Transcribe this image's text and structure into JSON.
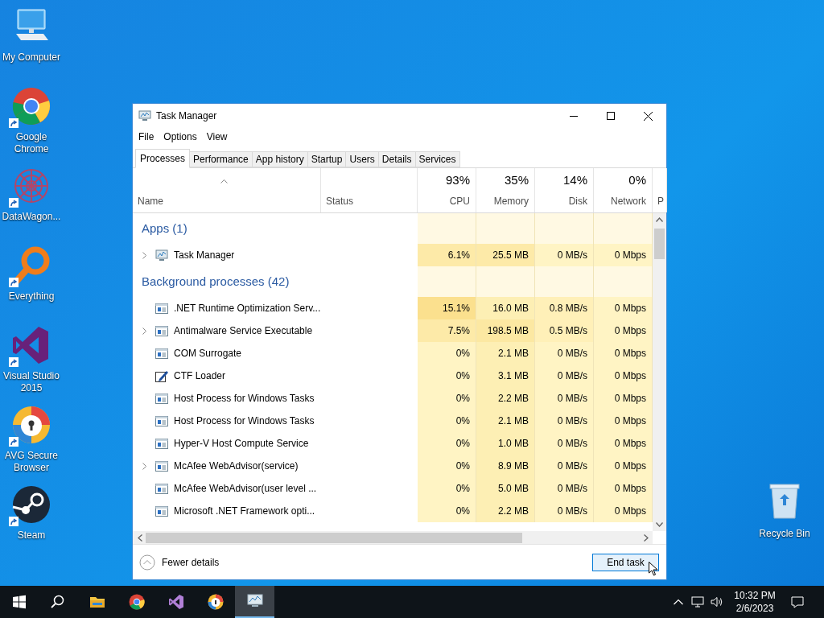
{
  "desktop_icons": [
    {
      "kind": "computer",
      "label": "My Computer",
      "shortcut": false
    },
    {
      "kind": "chrome",
      "label": "Google Chrome",
      "shortcut": true
    },
    {
      "kind": "datawagon",
      "label": "DataWagon...",
      "shortcut": true
    },
    {
      "kind": "everything",
      "label": "Everything",
      "shortcut": true
    },
    {
      "kind": "vs",
      "label": "Visual Studio 2015",
      "shortcut": true
    },
    {
      "kind": "avg",
      "label": "AVG Secure Browser",
      "shortcut": true
    },
    {
      "kind": "steam",
      "label": "Steam",
      "shortcut": true
    }
  ],
  "recycle_bin": {
    "label": "Recycle Bin"
  },
  "window": {
    "title": "Task Manager"
  },
  "menu": [
    "File",
    "Options",
    "View"
  ],
  "tabs": [
    {
      "label": "Processes",
      "selected": true
    },
    {
      "label": "Performance",
      "selected": false
    },
    {
      "label": "App history",
      "selected": false
    },
    {
      "label": "Startup",
      "selected": false
    },
    {
      "label": "Users",
      "selected": false
    },
    {
      "label": "Details",
      "selected": false
    },
    {
      "label": "Services",
      "selected": false
    }
  ],
  "columns": [
    {
      "label": "Name"
    },
    {
      "label": "Status"
    },
    {
      "label": "CPU",
      "total": "93%"
    },
    {
      "label": "Memory",
      "total": "35%"
    },
    {
      "label": "Disk",
      "total": "14%"
    },
    {
      "label": "Network",
      "total": "0%"
    },
    {
      "label": "P"
    }
  ],
  "groups": [
    {
      "title": "Apps (1)",
      "rows": [
        {
          "kind": "monitor",
          "name": "Task Manager",
          "expandable": true,
          "cells": [
            {
              "text": "6.1%",
              "color": "#fdeaa8"
            },
            {
              "text": "25.5 MB",
              "color": "#fdeaa8"
            },
            {
              "text": "0 MB/s",
              "color": "#fff4c4"
            },
            {
              "text": "0 Mbps",
              "color": "#fff4c4"
            }
          ]
        }
      ]
    },
    {
      "title": "Background processes (42)",
      "rows": [
        {
          "kind": "service",
          "name": ".NET Runtime Optimization Serv...",
          "expandable": false,
          "cells": [
            {
              "text": "15.1%",
              "color": "#fbe08e"
            },
            {
              "text": "16.0 MB",
              "color": "#fdefb4"
            },
            {
              "text": "0.8 MB/s",
              "color": "#fff0b8"
            },
            {
              "text": "0 Mbps",
              "color": "#fff4c4"
            }
          ]
        },
        {
          "kind": "service",
          "name": "Antimalware Service Executable",
          "expandable": true,
          "cells": [
            {
              "text": "7.5%",
              "color": "#fdeaa8"
            },
            {
              "text": "198.5 MB",
              "color": "#fce8a2"
            },
            {
              "text": "0.5 MB/s",
              "color": "#fff0b8"
            },
            {
              "text": "0 Mbps",
              "color": "#fff4c4"
            }
          ]
        },
        {
          "kind": "service",
          "name": "COM Surrogate",
          "expandable": false,
          "cells": [
            {
              "text": "0%",
              "color": "#fff4c4"
            },
            {
              "text": "2.1 MB",
              "color": "#fdefb4"
            },
            {
              "text": "0 MB/s",
              "color": "#fff4c4"
            },
            {
              "text": "0 Mbps",
              "color": "#fff4c4"
            }
          ]
        },
        {
          "kind": "editor",
          "name": "CTF Loader",
          "expandable": false,
          "cells": [
            {
              "text": "0%",
              "color": "#fff4c4"
            },
            {
              "text": "3.1 MB",
              "color": "#fdefb4"
            },
            {
              "text": "0 MB/s",
              "color": "#fff4c4"
            },
            {
              "text": "0 Mbps",
              "color": "#fff4c4"
            }
          ]
        },
        {
          "kind": "service",
          "name": "Host Process for Windows Tasks",
          "expandable": false,
          "cells": [
            {
              "text": "0%",
              "color": "#fff4c4"
            },
            {
              "text": "2.2 MB",
              "color": "#fdefb4"
            },
            {
              "text": "0 MB/s",
              "color": "#fff4c4"
            },
            {
              "text": "0 Mbps",
              "color": "#fff4c4"
            }
          ]
        },
        {
          "kind": "service",
          "name": "Host Process for Windows Tasks",
          "expandable": false,
          "cells": [
            {
              "text": "0%",
              "color": "#fff4c4"
            },
            {
              "text": "2.1 MB",
              "color": "#fdefb4"
            },
            {
              "text": "0 MB/s",
              "color": "#fff4c4"
            },
            {
              "text": "0 Mbps",
              "color": "#fff4c4"
            }
          ]
        },
        {
          "kind": "service",
          "name": "Hyper-V Host Compute Service",
          "expandable": false,
          "cells": [
            {
              "text": "0%",
              "color": "#fff4c4"
            },
            {
              "text": "1.0 MB",
              "color": "#fdefb4"
            },
            {
              "text": "0 MB/s",
              "color": "#fff4c4"
            },
            {
              "text": "0 Mbps",
              "color": "#fff4c4"
            }
          ]
        },
        {
          "kind": "service",
          "name": "McAfee WebAdvisor(service)",
          "expandable": true,
          "cells": [
            {
              "text": "0%",
              "color": "#fff4c4"
            },
            {
              "text": "8.9 MB",
              "color": "#fdefb4"
            },
            {
              "text": "0 MB/s",
              "color": "#fff4c4"
            },
            {
              "text": "0 Mbps",
              "color": "#fff4c4"
            }
          ]
        },
        {
          "kind": "service",
          "name": "McAfee WebAdvisor(user level ...",
          "expandable": false,
          "cells": [
            {
              "text": "0%",
              "color": "#fff4c4"
            },
            {
              "text": "5.0 MB",
              "color": "#fdefb4"
            },
            {
              "text": "0 MB/s",
              "color": "#fff4c4"
            },
            {
              "text": "0 Mbps",
              "color": "#fff4c4"
            }
          ]
        },
        {
          "kind": "service",
          "name": "Microsoft .NET Framework opti...",
          "expandable": false,
          "cells": [
            {
              "text": "0%",
              "color": "#fff4c4"
            },
            {
              "text": "2.2 MB",
              "color": "#fdefb4"
            },
            {
              "text": "0 MB/s",
              "color": "#fff4c4"
            },
            {
              "text": "0 Mbps",
              "color": "#fff4c4"
            }
          ]
        }
      ]
    }
  ],
  "footer": {
    "details": "Fewer details",
    "end_task": "End task"
  },
  "taskbar": {
    "apps": [
      {
        "kind": "start",
        "selected": false
      },
      {
        "kind": "search",
        "selected": false
      },
      {
        "kind": "explorer",
        "selected": false
      },
      {
        "kind": "chrome",
        "selected": false
      },
      {
        "kind": "vs",
        "selected": false
      },
      {
        "kind": "avg",
        "selected": false
      },
      {
        "kind": "taskmanager",
        "selected": true
      }
    ],
    "time": "10:32 PM",
    "date": "2/6/2023"
  }
}
